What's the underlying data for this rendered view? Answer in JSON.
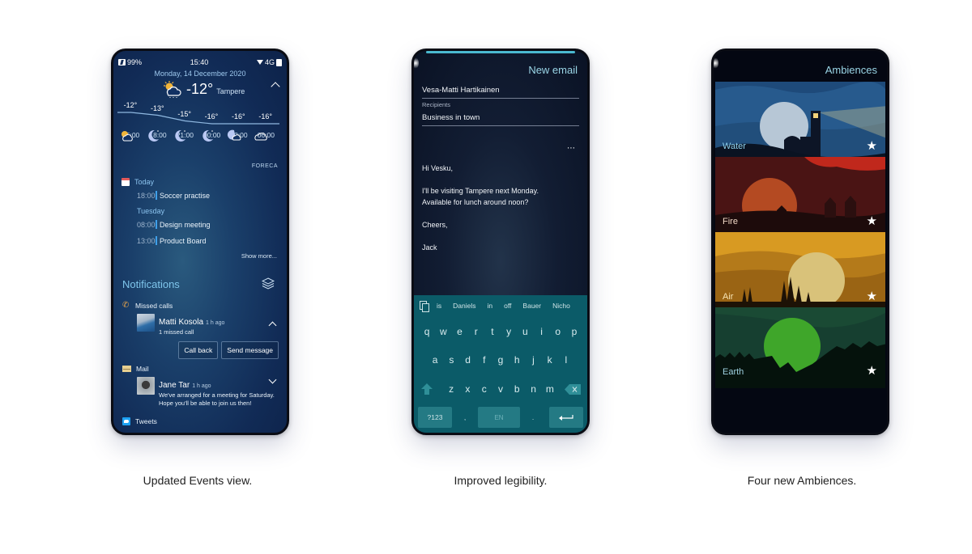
{
  "captions": [
    "Updated Events view.",
    "Improved legibility.",
    "Four new Ambiences."
  ],
  "events_view": {
    "status": {
      "battery": "99%",
      "time": "15:40",
      "network": "4G"
    },
    "date": "Monday, 14 December 2020",
    "weather": {
      "current_temp": "-12°",
      "city": "Tampere",
      "icon": "partly-cloudy-sun-icon",
      "forecast": [
        {
          "temp": "-12°",
          "time": "15:00",
          "icon": "partly-cloudy-sun-icon"
        },
        {
          "temp": "-13°",
          "time": "18:00",
          "icon": "moon-icon"
        },
        {
          "temp": "-15°",
          "time": "21:00",
          "icon": "moon-icon"
        },
        {
          "temp": "-16°",
          "time": "00:00",
          "icon": "moon-icon"
        },
        {
          "temp": "-16°",
          "time": "03:00",
          "icon": "moon-cloud-icon"
        },
        {
          "temp": "-16°",
          "time": "06:00",
          "icon": "cloud-icon"
        }
      ],
      "provider": "FORECA"
    },
    "calendar": {
      "days": [
        {
          "label": "Today",
          "events": [
            {
              "time": "18:00",
              "title": "Soccer practise"
            }
          ]
        },
        {
          "label": "Tuesday",
          "events": [
            {
              "time": "08:00",
              "title": "Design meeting"
            },
            {
              "time": "13:00",
              "title": "Product Board"
            }
          ]
        }
      ],
      "show_more": "Show more..."
    },
    "notifications": {
      "title": "Notifications",
      "missed_calls": {
        "label": "Missed calls",
        "name": "Matti Kosola",
        "ago": "1 h ago",
        "detail": "1 missed call",
        "actions": [
          "Call back",
          "Send message"
        ]
      },
      "mail": {
        "label": "Mail",
        "name": "Jane Tar",
        "ago": "1 h ago",
        "line1": "We've arranged for a meeting for Saturday.",
        "line2": "Hope you'll be able to join us then!"
      },
      "tweets": {
        "label": "Tweets"
      }
    }
  },
  "email_view": {
    "title": "New email",
    "to": "Vesa-Matti Hartikainen",
    "recipients_label": "Recipients",
    "subject": "Business in town",
    "more": "⋯",
    "body": [
      "Hi Vesku,",
      "I'll be visiting Tampere next Monday.",
      "Available for lunch around noon?",
      "Cheers,",
      "Jack"
    ],
    "keyboard": {
      "suggestions": [
        "is",
        "Daniels",
        "in",
        "off",
        "Bauer",
        "Nicho"
      ],
      "row1": [
        "q",
        "w",
        "e",
        "r",
        "t",
        "y",
        "u",
        "i",
        "o",
        "p"
      ],
      "row2": [
        "a",
        "s",
        "d",
        "f",
        "g",
        "h",
        "j",
        "k",
        "l"
      ],
      "row3": [
        "z",
        "x",
        "c",
        "v",
        "b",
        "n",
        "m"
      ],
      "symbols_key": "?123",
      "comma": ",",
      "space_label": "EN",
      "period": "."
    }
  },
  "ambiences_view": {
    "title": "Ambiences",
    "items": [
      {
        "name": "Water",
        "favorite": true,
        "label_color": "#8fd3ee"
      },
      {
        "name": "Fire",
        "favorite": true,
        "label_color": "#f1d8c6"
      },
      {
        "name": "Air",
        "favorite": true,
        "label_color": "#f6e4b4"
      },
      {
        "name": "Earth",
        "favorite": true,
        "label_color": "#9ed0e0"
      }
    ],
    "star_glyph": "★"
  }
}
